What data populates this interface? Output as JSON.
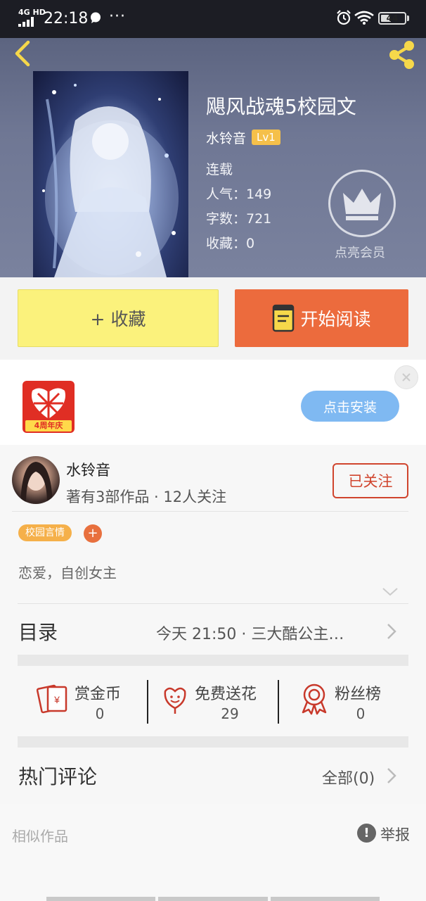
{
  "status_bar": {
    "network": "4G HD",
    "time": "22:18",
    "more": "···",
    "battery": "44",
    "battery_level": 0.44
  },
  "header": {
    "back_icon": "chevron-left-icon",
    "share_icon": "share-icon",
    "accent_color": "#f5c04a"
  },
  "book": {
    "title": "飓风战魂5校园文",
    "author": "水铃音",
    "level": "Lv1",
    "status": "连载",
    "popularity": "人气：149",
    "word_count": "字数：721",
    "favorites": "收藏：0",
    "member_label": "点亮会员"
  },
  "actions": {
    "collect_label": "+ 收藏",
    "read_label": "开始阅读",
    "collect_color": "#fbf27c",
    "read_color": "#ec6b3d"
  },
  "ad": {
    "logo_text": "4周年庆",
    "install_label": "点击安装",
    "close_icon": "close-icon"
  },
  "author_card": {
    "name": "水铃音",
    "stats": "著有3部作品 · 12人关注",
    "follow_label": "已关注",
    "tag": "校园言情",
    "tag_add": "+",
    "intro": "恋爱，自创女主"
  },
  "toc": {
    "title": "目录",
    "latest": "今天 21:50 · 三大酷公主…"
  },
  "rewards": [
    {
      "label": "赏金币",
      "count": "0",
      "icon": "coin-envelope-icon"
    },
    {
      "label": "免费送花",
      "count": "29",
      "icon": "flower-icon"
    },
    {
      "label": "粉丝榜",
      "count": "0",
      "icon": "medal-icon"
    }
  ],
  "comments": {
    "title": "热门评论",
    "all": "全部(0)"
  },
  "footer": {
    "similar": "相似作品",
    "report": "举报",
    "report_icon_glyph": "!"
  }
}
